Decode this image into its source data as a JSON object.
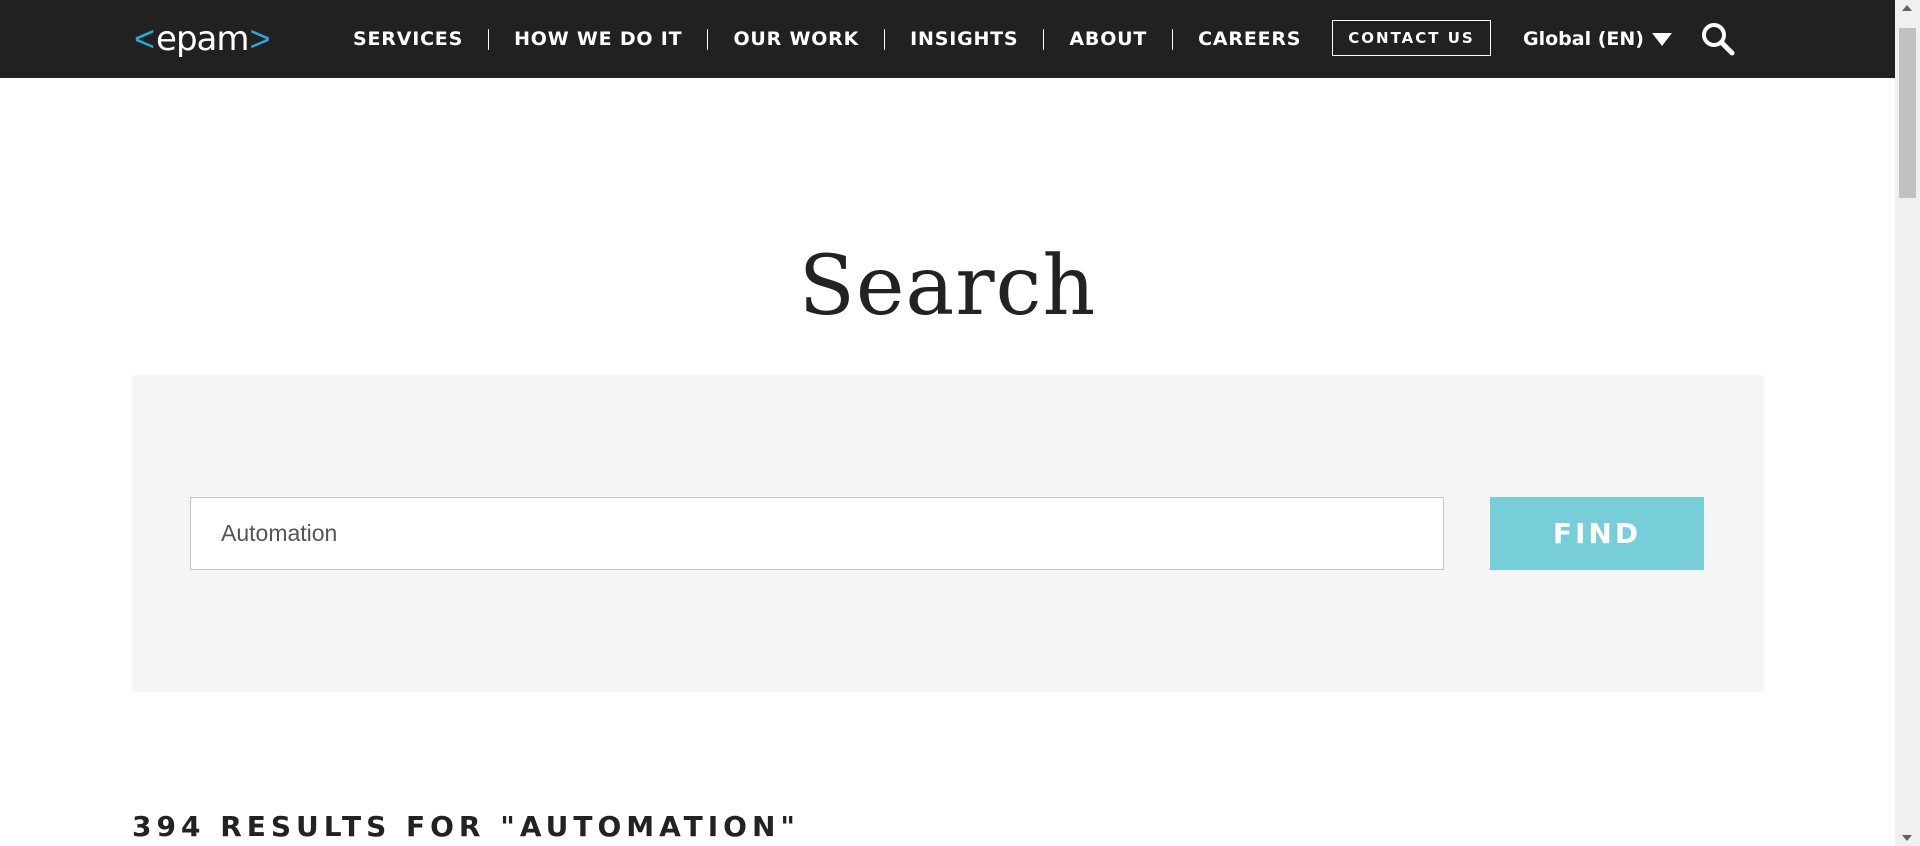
{
  "header": {
    "logo": {
      "bracket_left": "<",
      "word": "epam",
      "bracket_right": ">",
      "bracket_color": "#2aa8d6"
    },
    "nav": [
      {
        "label": "SERVICES"
      },
      {
        "label": "HOW WE DO IT"
      },
      {
        "label": "OUR WORK"
      },
      {
        "label": "INSIGHTS"
      },
      {
        "label": "ABOUT"
      },
      {
        "label": "CAREERS"
      }
    ],
    "contact_label": "CONTACT US",
    "language_label": "Global (EN)",
    "language_icon": "caret-down-icon",
    "search_icon": "search-icon",
    "background_color": "#222021"
  },
  "main": {
    "title": "Search",
    "search": {
      "value": "Automation",
      "button_label": "FIND",
      "button_color": "#77cdd8",
      "panel_color": "#f5f5f5"
    },
    "results_heading": "394 RESULTS FOR \"AUTOMATION\""
  }
}
